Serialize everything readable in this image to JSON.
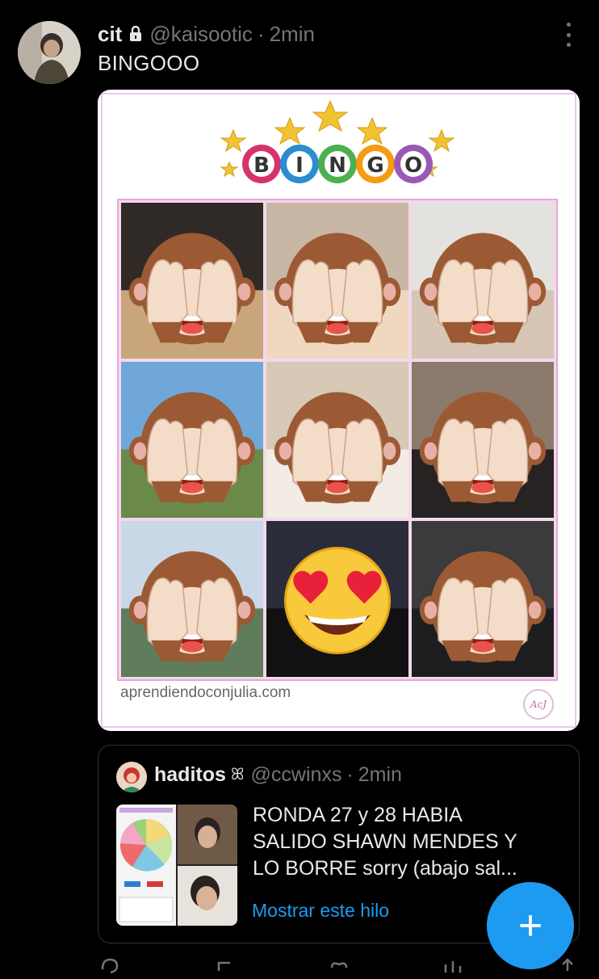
{
  "tweet": {
    "name": "cit",
    "handle": "@kaisootic",
    "separator": "·",
    "time": "2min",
    "text": "BINGOOO"
  },
  "media": {
    "banner": {
      "letters": [
        "B",
        "I",
        "N",
        "G",
        "O"
      ]
    },
    "site": "aprendiendoconjulia.com",
    "logo": "AcJ",
    "cells": [
      {
        "emoji": "see-no-evil-monkey-icon"
      },
      {
        "emoji": "see-no-evil-monkey-icon"
      },
      {
        "emoji": "see-no-evil-monkey-icon"
      },
      {
        "emoji": "see-no-evil-monkey-icon"
      },
      {
        "emoji": "see-no-evil-monkey-icon"
      },
      {
        "emoji": "see-no-evil-monkey-icon"
      },
      {
        "emoji": "see-no-evil-monkey-icon"
      },
      {
        "emoji": "heart-eyes-emoji-icon"
      },
      {
        "emoji": "see-no-evil-monkey-icon"
      }
    ]
  },
  "quote": {
    "name": "haditos",
    "handle": "@ccwinxs",
    "separator": "·",
    "time": "2min",
    "lines": [
      "RONDA 27 y 28 HABIA",
      "SALIDO SHAWN MENDES Y",
      "LO BORRE sorry (abajo sal..."
    ],
    "show_thread": "Mostrar este hilo"
  },
  "fab": {
    "label": "+",
    "icon": "compose-plus-icon"
  },
  "colors": {
    "accent": "#1d9bf0",
    "muted": "#71767b",
    "text": "#e7e9ea",
    "background": "#000000"
  }
}
